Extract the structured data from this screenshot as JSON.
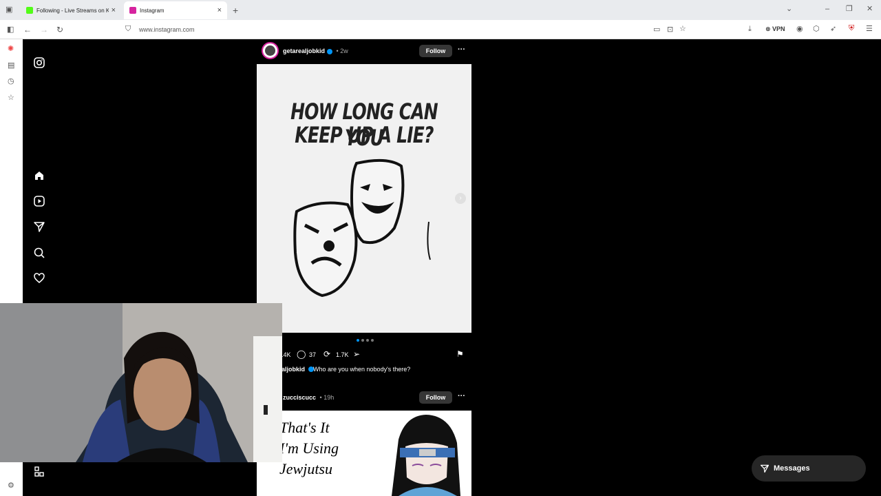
{
  "tabs": [
    {
      "title": "Following - Live Streams on Kick",
      "favicon_color": "#53fc18",
      "active": false
    },
    {
      "title": "Instagram",
      "favicon_color": "#d6249f",
      "active": true
    }
  ],
  "address_bar": {
    "url": "www.instagram.com"
  },
  "toolbar": {
    "vpn_label": "VPN"
  },
  "posts": [
    {
      "username": "getarealjobkid",
      "age": "2w",
      "follow_label": "Follow",
      "image_text": [
        "HOW LONG CAN YOU",
        "KEEP UP A LIE?"
      ],
      "likes": ".4K",
      "comments": "37",
      "reposts": "1.7K",
      "caption_user": "aljobkid",
      "caption_text": "Who are you when nobody's there?"
    },
    {
      "username": "zucciscucc",
      "age": "19h",
      "follow_label": "Follow",
      "image_text": [
        "That's It",
        "I'm Using",
        "Jewjutsu"
      ]
    }
  ],
  "messages": {
    "label": "Messages"
  },
  "icons": {
    "nav": [
      "instagram-logo-icon",
      "home-icon",
      "reels-icon",
      "direct-icon",
      "search-icon",
      "heart-icon",
      "more-icon"
    ],
    "browser_sidebar": [
      "sidebar-toggle-icon",
      "ai-icon",
      "tabs-icon",
      "history-icon",
      "bookmarks-icon",
      "settings-icon"
    ]
  }
}
